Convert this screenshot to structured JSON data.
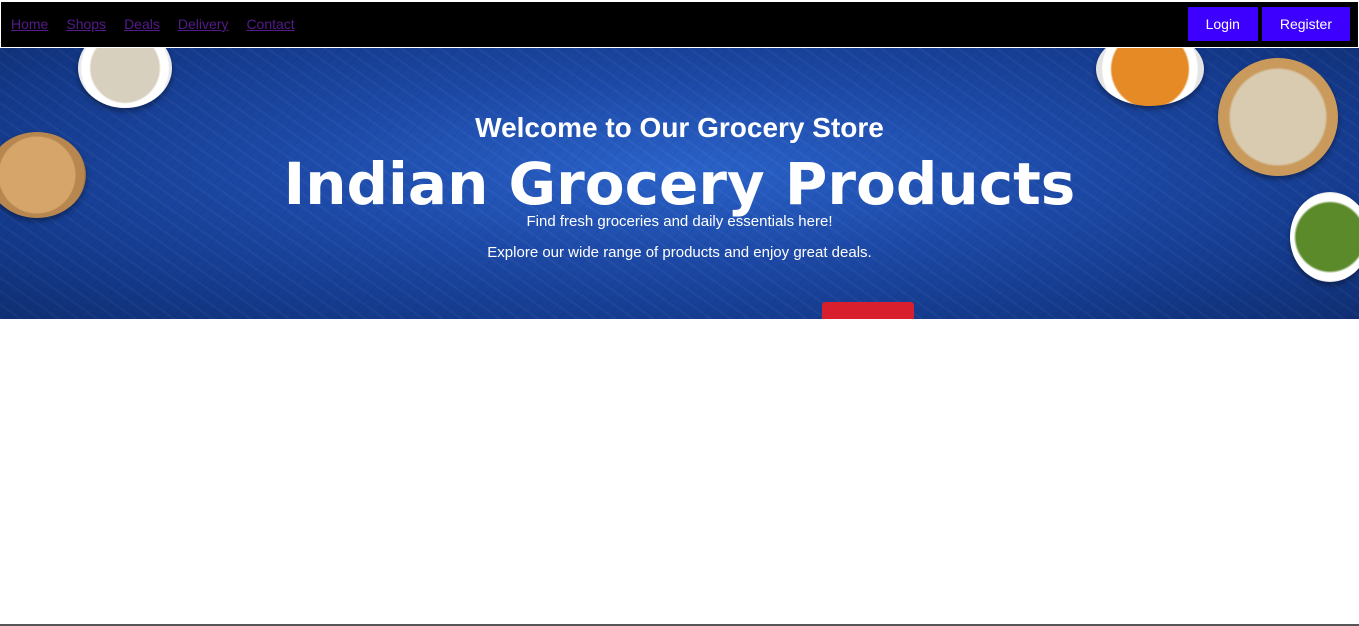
{
  "nav": {
    "links": [
      "Home",
      "Shops",
      "Deals",
      "Delivery",
      "Contact"
    ],
    "login_label": "Login",
    "register_label": "Register"
  },
  "hero": {
    "welcome": "Welcome to Our Grocery Store",
    "title": "Indian Grocery Products",
    "subtitle1": "Find fresh groceries and daily essentials here!",
    "subtitle2": "Explore our wide range of products and enjoy great deals."
  },
  "colors": {
    "navbar_bg": "#000000",
    "link_visited": "#551a8b",
    "button_bg": "#3d00ff",
    "hero_blue": "#1d4aa8"
  }
}
